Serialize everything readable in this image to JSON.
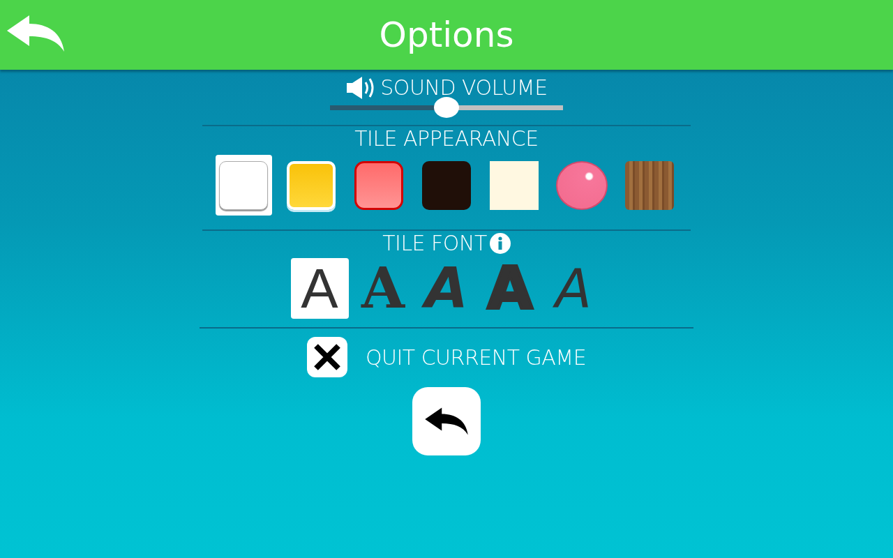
{
  "header": {
    "title": "Options"
  },
  "sound": {
    "label": "SOUND VOLUME",
    "level": 0.5
  },
  "tiles": {
    "label": "TILE APPEARANCE",
    "items": [
      {
        "kind": "white",
        "selected": true
      },
      {
        "kind": "yellow",
        "selected": false
      },
      {
        "kind": "red",
        "selected": false
      },
      {
        "kind": "dark",
        "selected": false
      },
      {
        "kind": "cream",
        "selected": false
      },
      {
        "kind": "bubble",
        "selected": false
      },
      {
        "kind": "wood",
        "selected": false
      }
    ]
  },
  "font": {
    "label": "TILE FONT",
    "items": [
      {
        "kind": "sans",
        "glyph": "A",
        "selected": true
      },
      {
        "kind": "serif",
        "glyph": "A",
        "selected": false
      },
      {
        "kind": "hand",
        "glyph": "A",
        "selected": false
      },
      {
        "kind": "block",
        "glyph": "A",
        "selected": false
      },
      {
        "kind": "thin",
        "glyph": "A",
        "selected": false
      }
    ]
  },
  "quit": {
    "label": "QUIT CURRENT GAME"
  }
}
